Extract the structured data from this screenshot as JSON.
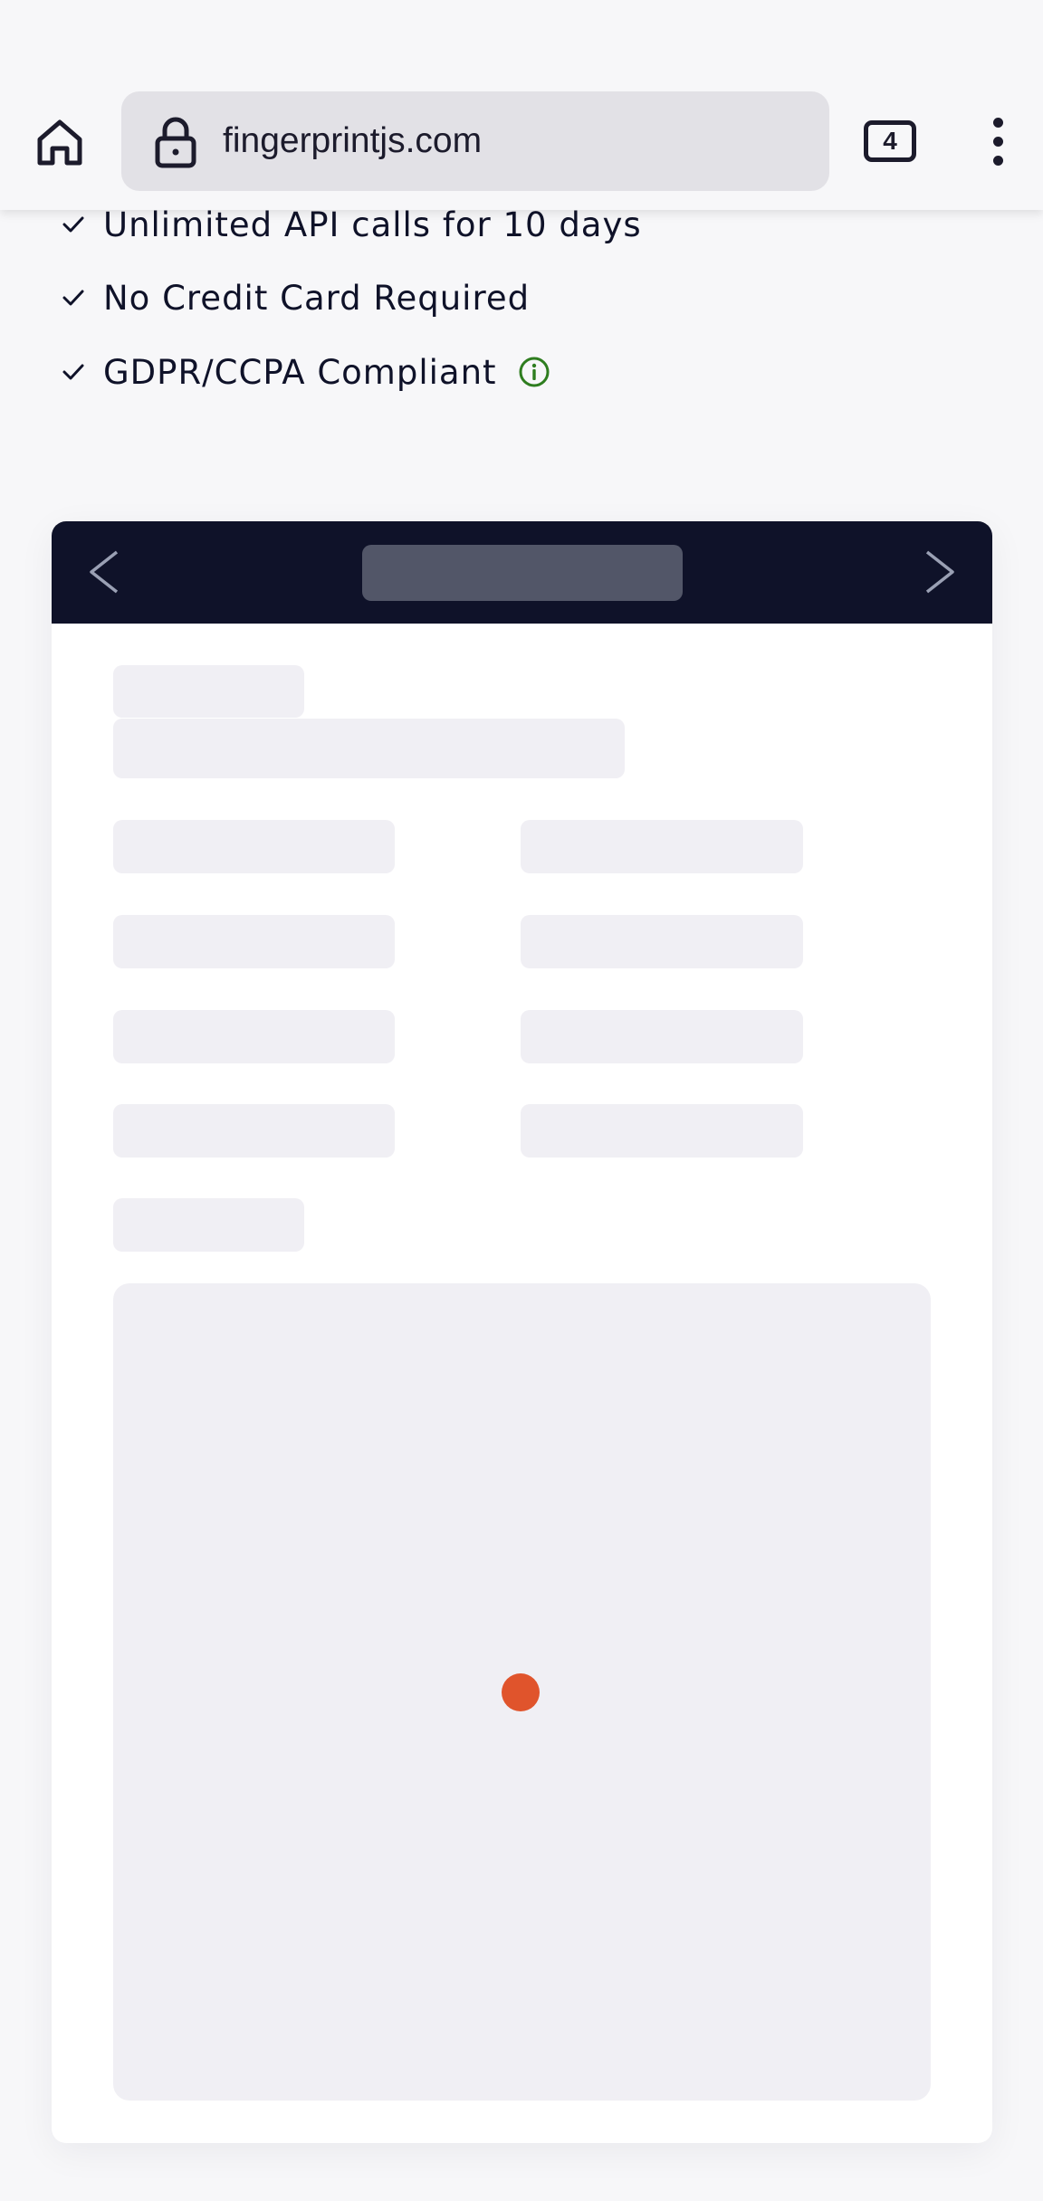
{
  "browser": {
    "url": "fingerprintjs.com",
    "tab_count": "4",
    "icons": {
      "home": "home-icon",
      "lock": "lock-icon",
      "menu": "more-vertical-icon"
    }
  },
  "features": [
    {
      "text": "Unlimited API calls for 10 days"
    },
    {
      "text": "No Credit Card Required"
    },
    {
      "text": "GDPR/CCPA Compliant",
      "info_icon": true
    }
  ],
  "demo": {
    "header_color": "#0f1229",
    "skeleton_color": "#f0eff4",
    "spinner_color": "#e0542c",
    "state": "loading"
  },
  "colors": {
    "check": "#0f1229",
    "info_icon": "#2e7d1f"
  }
}
